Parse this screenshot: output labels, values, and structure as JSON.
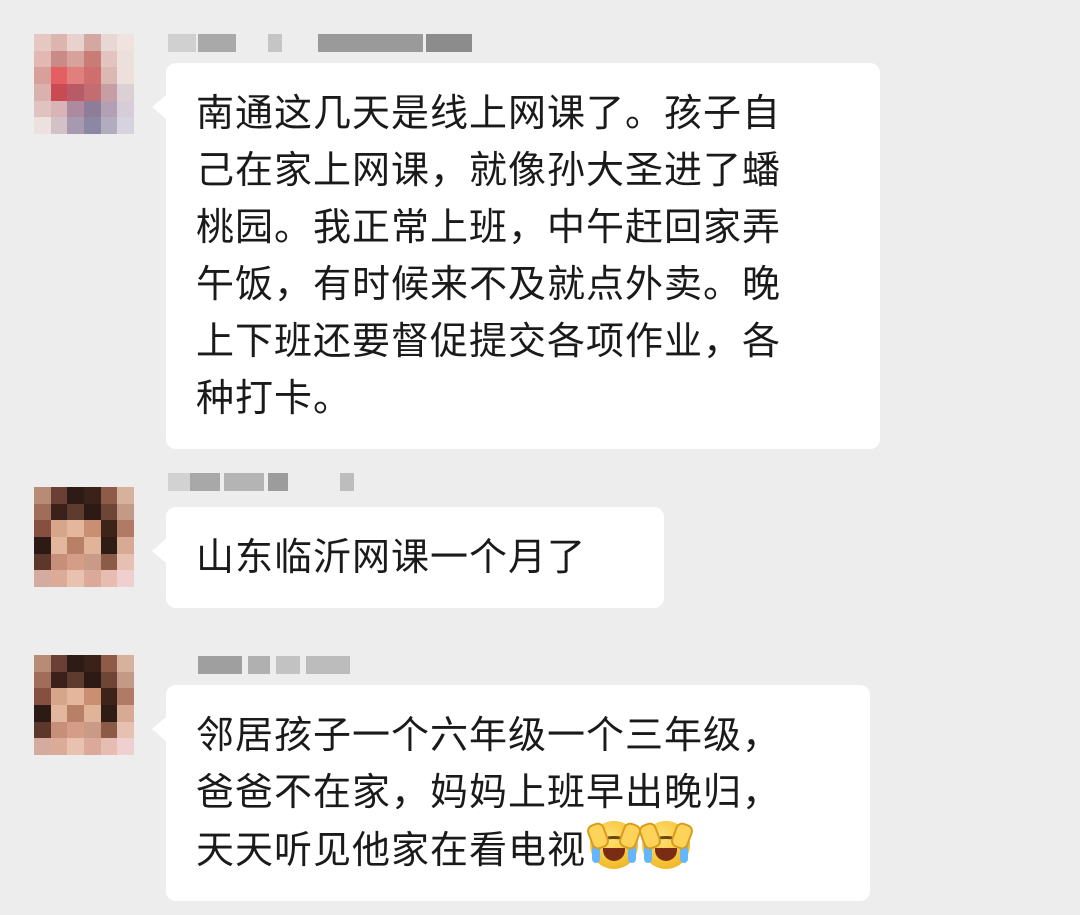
{
  "messages": [
    {
      "text_lines": [
        "南通这几天是线上网课了。孩子自",
        "己在家上网课，就像孙大圣进了蟠",
        "桃园。我正常上班，中午赶回家弄",
        "午饭，有时候来不及就点外卖。晚",
        "上下班还要督促提交各项作业，各",
        "种打卡。"
      ]
    },
    {
      "text_lines": [
        "山东临沂网课一个月了"
      ]
    },
    {
      "text_lines": [
        "邻居孩子一个六年级一个三年级，",
        "爸爸不在家，妈妈上班早出晚归，",
        "天天听见他家在看电视"
      ],
      "trailing_icons": [
        "face-palm-crying-emoji",
        "face-palm-crying-emoji"
      ]
    }
  ],
  "colors": {
    "background": "#ededed",
    "bubble": "#ffffff",
    "text": "#1a1a1a",
    "blur": "#b9b9b9"
  }
}
